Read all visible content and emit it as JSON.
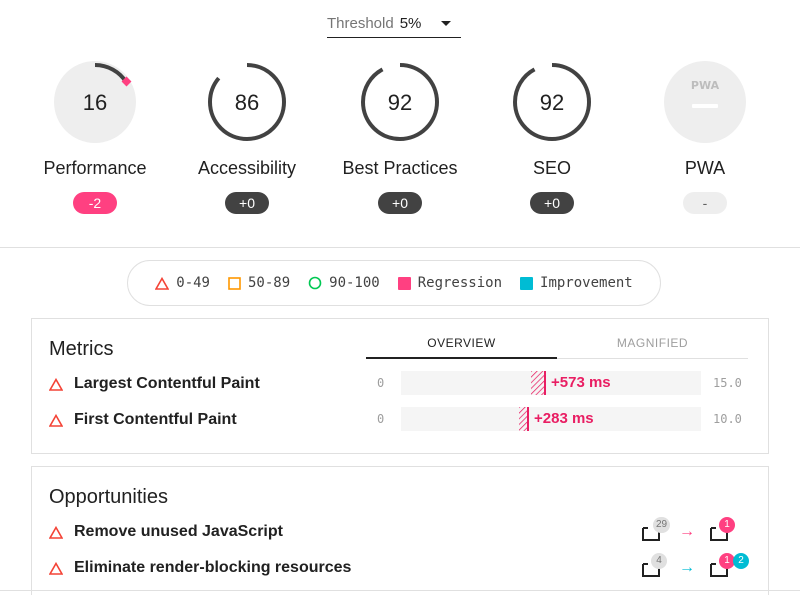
{
  "threshold": {
    "label": "Threshold",
    "value": "5%"
  },
  "gauges": [
    {
      "name": "Performance",
      "score": "16",
      "delta": "-2",
      "progress": 0.16
    },
    {
      "name": "Accessibility",
      "score": "86",
      "delta": "+0",
      "progress": 0.86
    },
    {
      "name": "Best Practices",
      "score": "92",
      "delta": "+0",
      "progress": 0.92
    },
    {
      "name": "SEO",
      "score": "92",
      "delta": "+0",
      "progress": 0.92
    },
    {
      "name": "PWA",
      "score": "PWA",
      "delta": "-"
    }
  ],
  "legend": {
    "fail": "0-49",
    "average": "50-89",
    "pass": "90-100",
    "regression": "Regression",
    "improvement": "Improvement"
  },
  "colors": {
    "regression": "#ff4081",
    "improvement": "#00bcd4",
    "fail": "#f44336",
    "average": "#ff9800",
    "pass": "#00c853",
    "dark": "#424242"
  },
  "metrics": {
    "title": "Metrics",
    "tabs": [
      "OVERVIEW",
      "MAGNIFIED"
    ],
    "rows": [
      {
        "name": "Largest Contentful Paint",
        "min": "0",
        "max": "15.0",
        "delta_text": "+573 ms"
      },
      {
        "name": "First Contentful Paint",
        "min": "0",
        "max": "10.0",
        "delta_text": "+283 ms"
      }
    ]
  },
  "opportunities": {
    "title": "Opportunities",
    "rows": [
      {
        "name": "Remove unused JavaScript",
        "before": "29",
        "after_a": "1",
        "after_b": ""
      },
      {
        "name": "Eliminate render-blocking resources",
        "before": "4",
        "after_a": "1",
        "after_b": "2"
      }
    ]
  }
}
